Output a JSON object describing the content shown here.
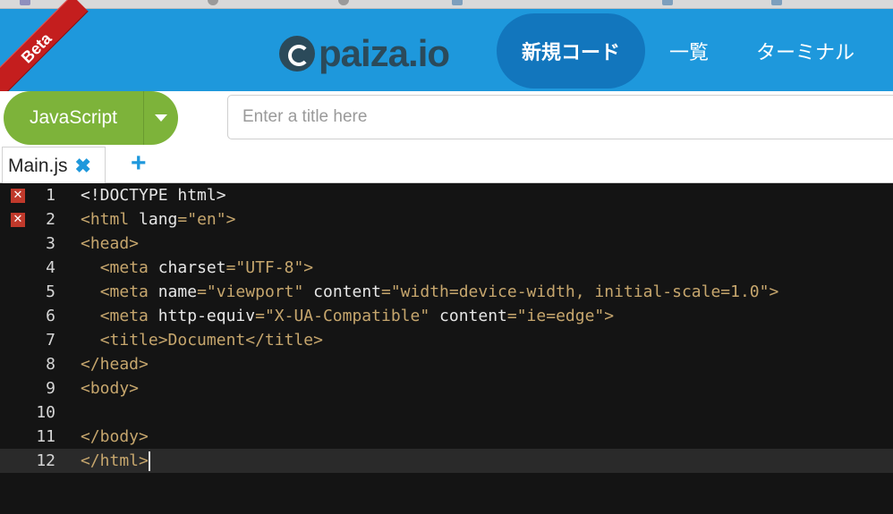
{
  "header": {
    "logo_text": "paiza.io",
    "beta_label": "Beta",
    "nav": {
      "new_code": "新規コード",
      "list": "一覧",
      "terminal": "ターミナル"
    }
  },
  "toolbar": {
    "language": "JavaScript",
    "title_placeholder": "Enter a title here"
  },
  "tabs": {
    "file_name": "Main.js",
    "close_symbol": "✖",
    "add_symbol": "+"
  },
  "editor": {
    "error_symbol": "✕",
    "lines": [
      {
        "number": "1",
        "error": true
      },
      {
        "number": "2",
        "error": true
      },
      {
        "number": "3",
        "error": false
      },
      {
        "number": "4",
        "error": false
      },
      {
        "number": "5",
        "error": false
      },
      {
        "number": "6",
        "error": false
      },
      {
        "number": "7",
        "error": false
      },
      {
        "number": "8",
        "error": false
      },
      {
        "number": "9",
        "error": false
      },
      {
        "number": "10",
        "error": false
      },
      {
        "number": "11",
        "error": false
      },
      {
        "number": "12",
        "error": false
      }
    ],
    "code": {
      "l1": "<!DOCTYPE html>",
      "l2_tag": "<html",
      "l2_attr": "lang",
      "l2_eq": "=",
      "l2_val": "\"en\"",
      "l2_close": ">",
      "l3": "<head>",
      "l4_tag": "<meta",
      "l4_attr": "charset",
      "l4_eq": "=",
      "l4_val": "\"UTF-8\"",
      "l4_close": ">",
      "l5_tag": "<meta",
      "l5_attr1": "name",
      "l5_eq1": "=",
      "l5_val1": "\"viewport\"",
      "l5_attr2": "content",
      "l5_eq2": "=",
      "l5_val2": "\"width=device-width, initial-scale=1.0\"",
      "l5_close": ">",
      "l6_tag": "<meta",
      "l6_attr1": "http-equiv",
      "l6_eq1": "=",
      "l6_val1": "\"X-UA-Compatible\"",
      "l6_attr2": "content",
      "l6_eq2": "=",
      "l6_val2": "\"ie=edge\"",
      "l6_close": ">",
      "l7_open": "<title>",
      "l7_text": "Document",
      "l7_close": "</title>",
      "l8": "</head>",
      "l9": "<body>",
      "l10": "",
      "l11": "</body>",
      "l12": "</html>"
    }
  },
  "colors": {
    "header_bg": "#1e98dc",
    "nav_active_bg": "#1276bd",
    "language_button": "#7db33a",
    "beta_ribbon": "#c41e1e",
    "editor_bg": "#141414",
    "tag_color": "#c6a66d"
  }
}
